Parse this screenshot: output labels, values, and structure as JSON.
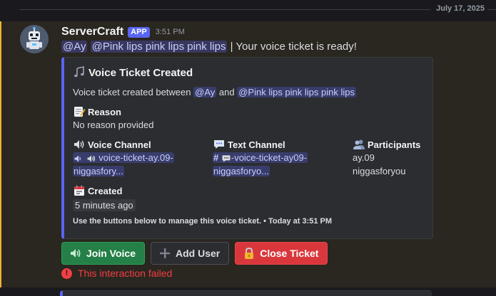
{
  "date_divider": {
    "date": "July 17, 2025"
  },
  "message": {
    "username": "ServerCraft",
    "badge": "APP",
    "timestamp": "3:51 PM",
    "content": {
      "mention1": "@Ay",
      "mention2": "@Pink lips pink lips pink lips",
      "text": "| Your voice ticket is ready!"
    },
    "embed": {
      "title_icon": "musical-notes-icon",
      "title": "Voice Ticket Created",
      "desc_prefix": "Voice ticket created between",
      "desc_mention1": "@Ay",
      "desc_and": "and",
      "desc_mention2": "@Pink lips pink lips pink lips",
      "fields": {
        "reason": {
          "icon": "memo-icon",
          "name": "Reason",
          "value": "No reason provided"
        },
        "voice_channel": {
          "icon": "speaker-icon",
          "name": "Voice Channel",
          "value_line1": "voice-ticket-ay.09-",
          "value_line2": "niggasfory..."
        },
        "text_channel": {
          "icon": "speech-bubble-icon",
          "name": "Text Channel",
          "value_line1": "-voice-ticket-ay09-",
          "value_line2": "niggasforyo..."
        },
        "participants": {
          "icon": "people-icon",
          "name": "Participants",
          "value_line1": "ay.09",
          "value_line2": "niggasforyou"
        },
        "created": {
          "icon": "calendar-icon",
          "name": "Created",
          "value": "5 minutes ago"
        }
      },
      "footer": "Use the buttons below to manage this voice ticket. • Today at 3:51 PM"
    },
    "buttons": {
      "join": {
        "label": "Join Voice",
        "icon": "speaker-icon",
        "color": "#248046"
      },
      "add": {
        "label": "Add User",
        "icon": "plus-icon"
      },
      "close": {
        "label": "Close Ticket",
        "icon": "lock-icon",
        "color": "#da373c"
      }
    },
    "error": "This interaction failed"
  },
  "colors": {
    "accent": "#5865f2",
    "highlight_border": "#f0b232",
    "error": "#f23f43"
  }
}
